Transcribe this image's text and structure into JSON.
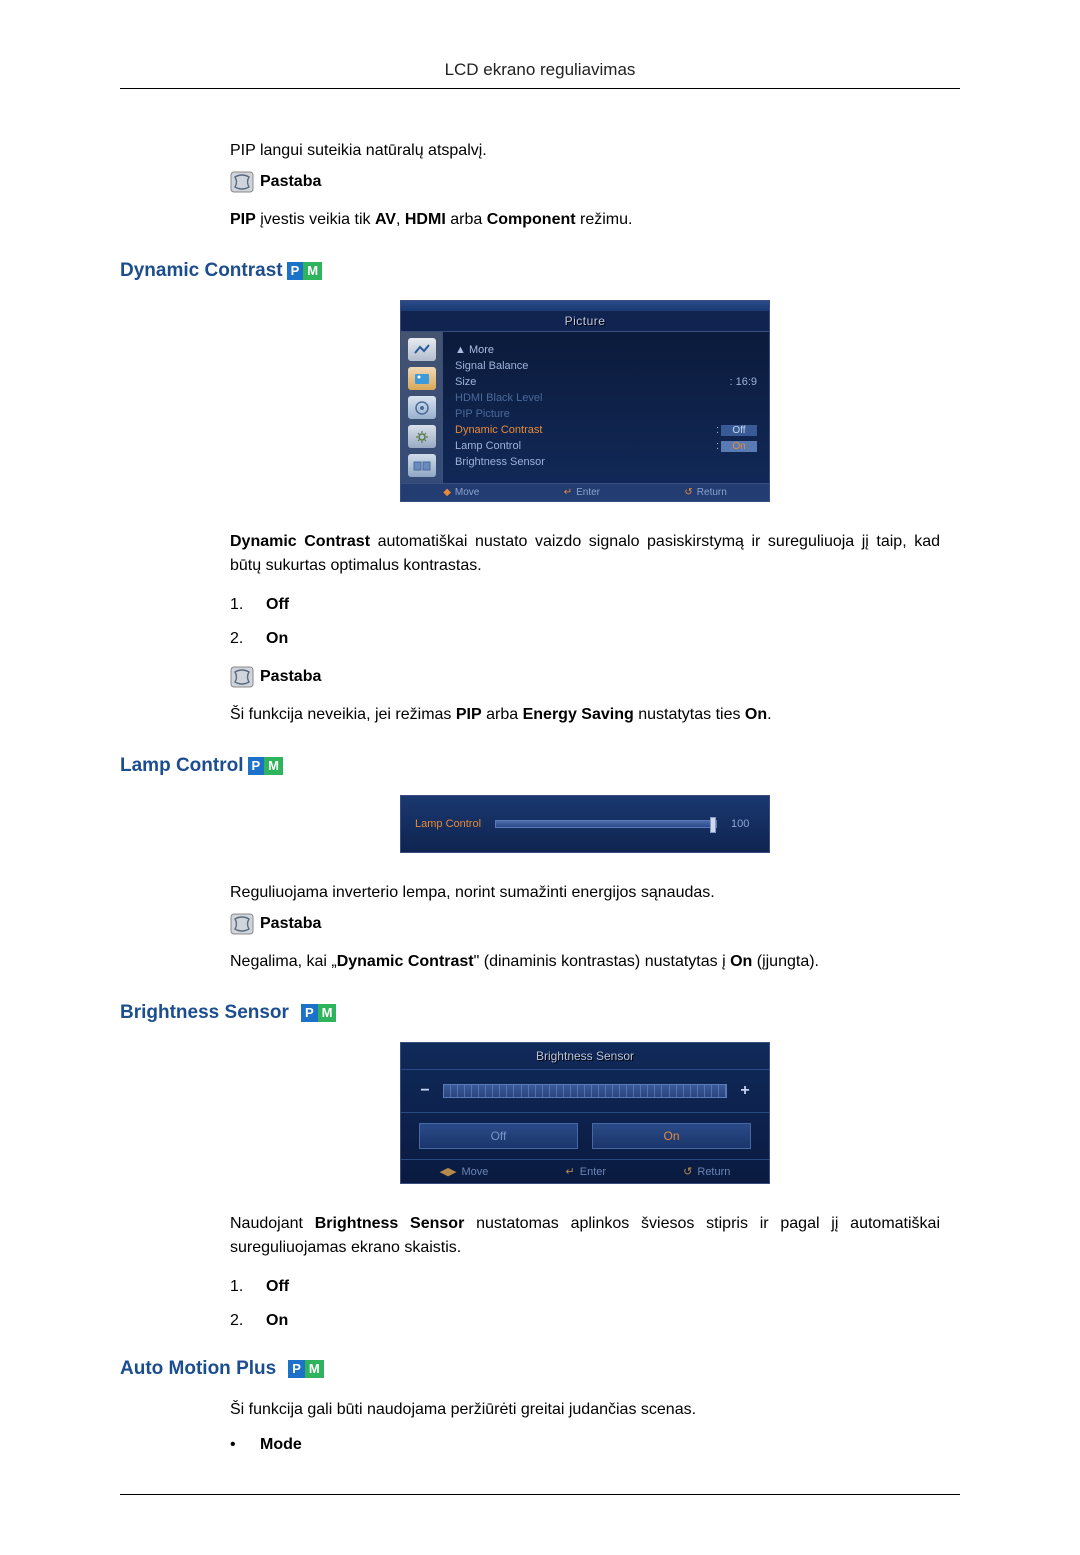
{
  "page_header": "LCD ekrano reguliavimas",
  "intro_text": "PIP langui suteikia natūralų atspalvį.",
  "note_label": "Pastaba",
  "pip_note": {
    "prefix": "PIP",
    "middle": " įvestis veikia tik ",
    "av": "AV",
    "sep1": ", ",
    "hdmi": "HDMI",
    "sep2": " arba ",
    "component": "Component",
    "suffix": " režimu."
  },
  "sections": {
    "dynamic_contrast": {
      "title": "Dynamic Contrast",
      "desc_prefix": "Dynamic Contrast",
      "desc_body": " automatiškai nustato vaizdo signalo pasiskirstymą ir sureguliuoja jį taip, kad būtų sukurtas optimalus kontrastas.",
      "options": [
        {
          "num": "1.",
          "label": "Off"
        },
        {
          "num": "2.",
          "label": "On"
        }
      ],
      "note_text_a": "Ši funkcija neveikia, jei režimas ",
      "note_pip": "PIP",
      "note_or": " arba ",
      "note_es": "Energy Saving",
      "note_set": " nustatytas ties ",
      "note_on": "On",
      "note_end": "."
    },
    "lamp_control": {
      "title": "Lamp Control",
      "desc": "Reguliuojama inverterio lempa, norint sumažinti energijos sąnaudas.",
      "note_a": "Negalima, kai „",
      "note_dc": "Dynamic Contrast",
      "note_b": "\" (dinaminis kontrastas) nustatytas į ",
      "note_on": "On",
      "note_c": " (įjungta)."
    },
    "brightness_sensor": {
      "title": "Brightness Sensor",
      "desc_a": "Naudojant ",
      "desc_bold": "Brightness Sensor",
      "desc_b": " nustatomas aplinkos šviesos stipris ir pagal jį automatiškai sureguliuojamas ekrano skaistis.",
      "options": [
        {
          "num": "1.",
          "label": "Off"
        },
        {
          "num": "2.",
          "label": "On"
        }
      ]
    },
    "auto_motion_plus": {
      "title": "Auto Motion Plus",
      "desc": "Ši funkcija gali būti naudojama peržiūrėti greitai judančias scenas.",
      "bullets": [
        {
          "dot": "•",
          "label": "Mode"
        }
      ]
    }
  },
  "osd": {
    "title": "Picture",
    "more": "▲ More",
    "rows": [
      {
        "label": "Signal Balance",
        "value": ""
      },
      {
        "label": "Size",
        "value": ": 16:9"
      }
    ],
    "dimmed": [
      "HDMI Black Level",
      "PIP Picture"
    ],
    "highlight_row": {
      "label": "Dynamic Contrast",
      "value": "Off"
    },
    "lamp_row": {
      "label": "Lamp Control",
      "value": "On"
    },
    "bs_row": "Brightness Sensor",
    "footer": {
      "move": "Move",
      "enter": "Enter",
      "return": "Return"
    }
  },
  "lamp_osd": {
    "label": "Lamp Control",
    "value": "100"
  },
  "bs_osd": {
    "title": "Brightness Sensor",
    "minus": "−",
    "plus": "+",
    "off": "Off",
    "on": "On",
    "footer": {
      "move": "Move",
      "enter": "Enter",
      "return": "Return"
    }
  }
}
